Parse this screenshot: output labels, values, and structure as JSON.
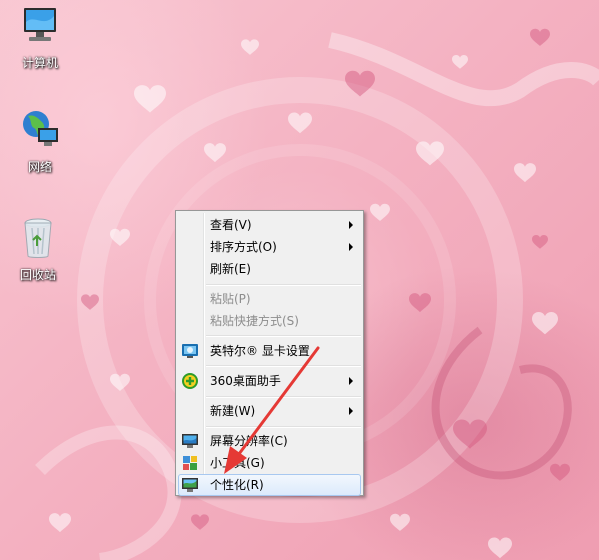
{
  "desktop": {
    "icons": [
      {
        "label": "计算机",
        "icon": "computer-icon"
      },
      {
        "label": "网络",
        "icon": "network-icon"
      },
      {
        "label": "回收站",
        "icon": "recycle-bin-icon"
      }
    ]
  },
  "context_menu": {
    "items": [
      {
        "label": "查看(V)",
        "submenu": true
      },
      {
        "label": "排序方式(O)",
        "submenu": true
      },
      {
        "label": "刷新(E)"
      },
      {
        "label": "粘贴(P)",
        "disabled": true
      },
      {
        "label": "粘贴快捷方式(S)",
        "disabled": true
      },
      {
        "label": "英特尔® 显卡设置",
        "icon": "intel-graphics-icon"
      },
      {
        "label": "360桌面助手",
        "icon": "360-desktop-icon",
        "submenu": true
      },
      {
        "label": "新建(W)",
        "submenu": true
      },
      {
        "label": "屏幕分辨率(C)",
        "icon": "screen-resolution-icon"
      },
      {
        "label": "小工具(G)",
        "icon": "gadgets-icon"
      },
      {
        "label": "个性化(R)",
        "icon": "personalize-icon",
        "highlighted": true
      }
    ]
  },
  "colors": {
    "annotation_arrow": "#e53935",
    "menu_background": "#f0f0f0",
    "wallpaper_pink": "#f4b2c2"
  }
}
